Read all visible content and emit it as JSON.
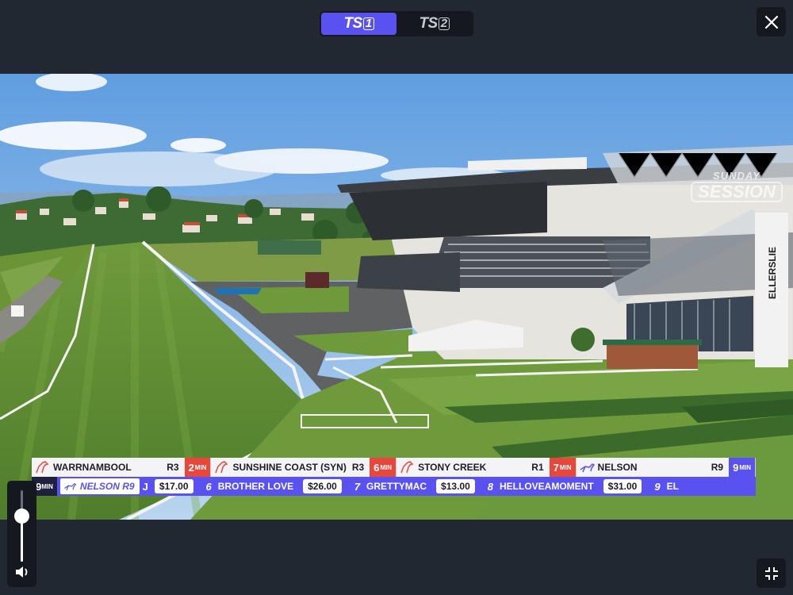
{
  "channels": {
    "tabs": [
      {
        "label": "TS",
        "number": "1",
        "active": true
      },
      {
        "label": "TS",
        "number": "2",
        "active": false
      }
    ]
  },
  "video": {
    "watermark_top": "SUNDAY",
    "watermark_main": "SESSION",
    "grandstand_sign": "ELLERSLIE"
  },
  "upcoming_races": [
    {
      "venue": "WARRNAMBOOL",
      "race": "R3",
      "time": "2",
      "unit": "MIN",
      "icon": "horse-icon",
      "color": "#e8473c"
    },
    {
      "venue": "SUNSHINE COAST (SYN)",
      "race": "R3",
      "time": "6",
      "unit": "MIN",
      "icon": "horse-icon",
      "color": "#e8473c"
    },
    {
      "venue": "STONY CREEK",
      "race": "R1",
      "time": "7",
      "unit": "MIN",
      "icon": "horse-icon",
      "color": "#e8473c"
    },
    {
      "venue": "NELSON",
      "race": "R9",
      "time": "9",
      "unit": "MIN",
      "icon": "greyhound-icon",
      "color": "#5a52f0"
    }
  ],
  "odds_ticker": {
    "lead_time": "9",
    "lead_unit": "MIN",
    "current_race": "NELSON R9",
    "prefix": "J",
    "items": [
      {
        "price": "$17.00"
      },
      {
        "number": "6",
        "runner": "BROTHER LOVE",
        "price": "$26.00"
      },
      {
        "number": "7",
        "runner": "GRETTYMAC",
        "price": "$13.00"
      },
      {
        "number": "8",
        "runner": "HELLOVEAMOMENT",
        "price": "$31.00"
      },
      {
        "number": "9",
        "runner": "EL"
      }
    ]
  },
  "volume": {
    "level": 0.63
  }
}
